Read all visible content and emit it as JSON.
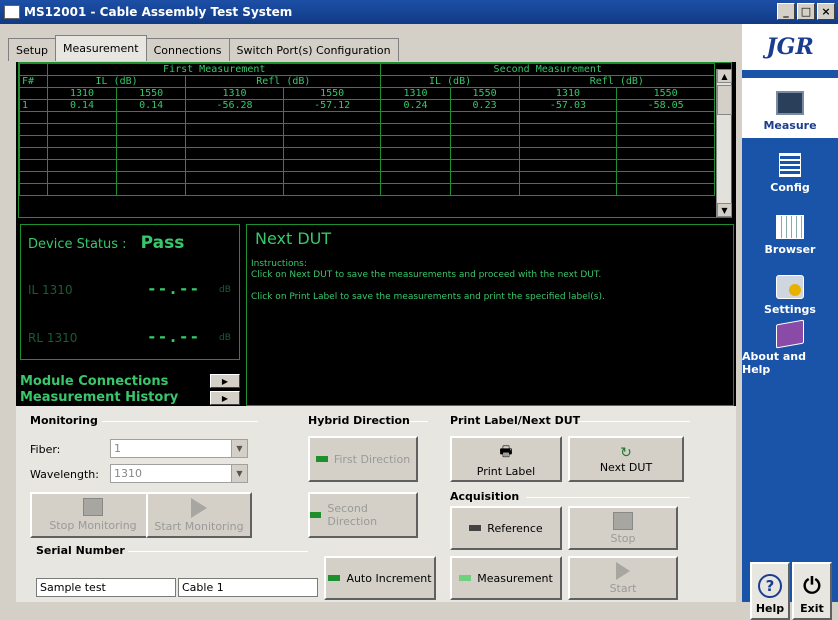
{
  "window": {
    "title": "MS12001 - Cable Assembly Test System",
    "buttons": [
      "_",
      "□",
      "×"
    ]
  },
  "tabs": [
    {
      "label": "Setup",
      "active": false
    },
    {
      "label": "Measurement",
      "active": true
    },
    {
      "label": "Connections",
      "active": false
    },
    {
      "label": "Switch Port(s) Configuration",
      "active": false
    }
  ],
  "grid": {
    "group_headers": [
      "First Measurement",
      "Second Measurement"
    ],
    "col_num_label": "F#",
    "il_label": "IL (dB)",
    "refl_label": "Refl (dB)",
    "wavelengths": [
      "1310",
      "1550",
      "1310",
      "1550",
      "1310",
      "1550",
      "1310",
      "1550"
    ],
    "rows": [
      [
        "1",
        "0.14",
        "0.14",
        "-56.28",
        "-57.12",
        "0.24",
        "0.23",
        "-57.03",
        "-58.05"
      ],
      [
        "",
        "",
        "",
        "",
        "",
        "",
        "",
        "",
        ""
      ],
      [
        "",
        "",
        "",
        "",
        "",
        "",
        "",
        "",
        ""
      ],
      [
        "",
        "",
        "",
        "",
        "",
        "",
        "",
        "",
        ""
      ],
      [
        "",
        "",
        "",
        "",
        "",
        "",
        "",
        "",
        ""
      ],
      [
        "",
        "",
        "",
        "",
        "",
        "",
        "",
        "",
        ""
      ],
      [
        "",
        "",
        "",
        "",
        "",
        "",
        "",
        "",
        ""
      ],
      [
        "",
        "",
        "",
        "",
        "",
        "",
        "",
        "",
        ""
      ]
    ]
  },
  "device": {
    "status_label": "Device Status :",
    "status_value": "Pass",
    "il_label": "IL 1310",
    "il_value": "--.--",
    "rl_label": "RL 1310",
    "rl_value": "--.--",
    "unit": "dB",
    "module_connections": "Module Connections",
    "measurement_history": "Measurement History"
  },
  "next_dut": {
    "title": "Next DUT",
    "instructions_label": "Instructions:",
    "line1": "Click on Next DUT to save the measurements and proceed with the next DUT.",
    "line2": "Click on Print Label to save the measurements and print the specified label(s)."
  },
  "monitoring": {
    "title": "Monitoring",
    "fiber_label": "Fiber:",
    "fiber_value": "1",
    "wavelength_label": "Wavelength:",
    "wavelength_value": "1310",
    "stop_label": "Stop Monitoring",
    "start_label": "Start Monitoring"
  },
  "hybrid": {
    "title": "Hybrid Direction",
    "first": "First Direction",
    "second": "Second Direction"
  },
  "print": {
    "title": "Print Label/Next DUT",
    "print_label": "Print Label",
    "next_label": "Next DUT"
  },
  "acquisition": {
    "title": "Acquisition",
    "reference": "Reference",
    "stop": "Stop",
    "measurement": "Measurement",
    "start": "Start"
  },
  "serial": {
    "title": "Serial Number",
    "field1": "Sample test",
    "field2": "Cable 1",
    "auto_increment": "Auto Increment"
  },
  "sidebar": {
    "logo": "JGR",
    "items": [
      {
        "label": "Measure",
        "icon": "measure-icon",
        "active": true
      },
      {
        "label": "Config",
        "icon": "config-icon",
        "active": false
      },
      {
        "label": "Browser",
        "icon": "browser-icon",
        "active": false
      },
      {
        "label": "Settings",
        "icon": "settings-icon",
        "active": false
      },
      {
        "label": "About and Help",
        "icon": "about-help-icon",
        "active": false
      }
    ],
    "help": "Help",
    "exit": "Exit"
  },
  "colors": {
    "screen_green": "#38c76b",
    "grid_line": "#1e8f2d",
    "sidebar_blue": "#1a54a8",
    "title_blue": "#1c4fa7"
  }
}
